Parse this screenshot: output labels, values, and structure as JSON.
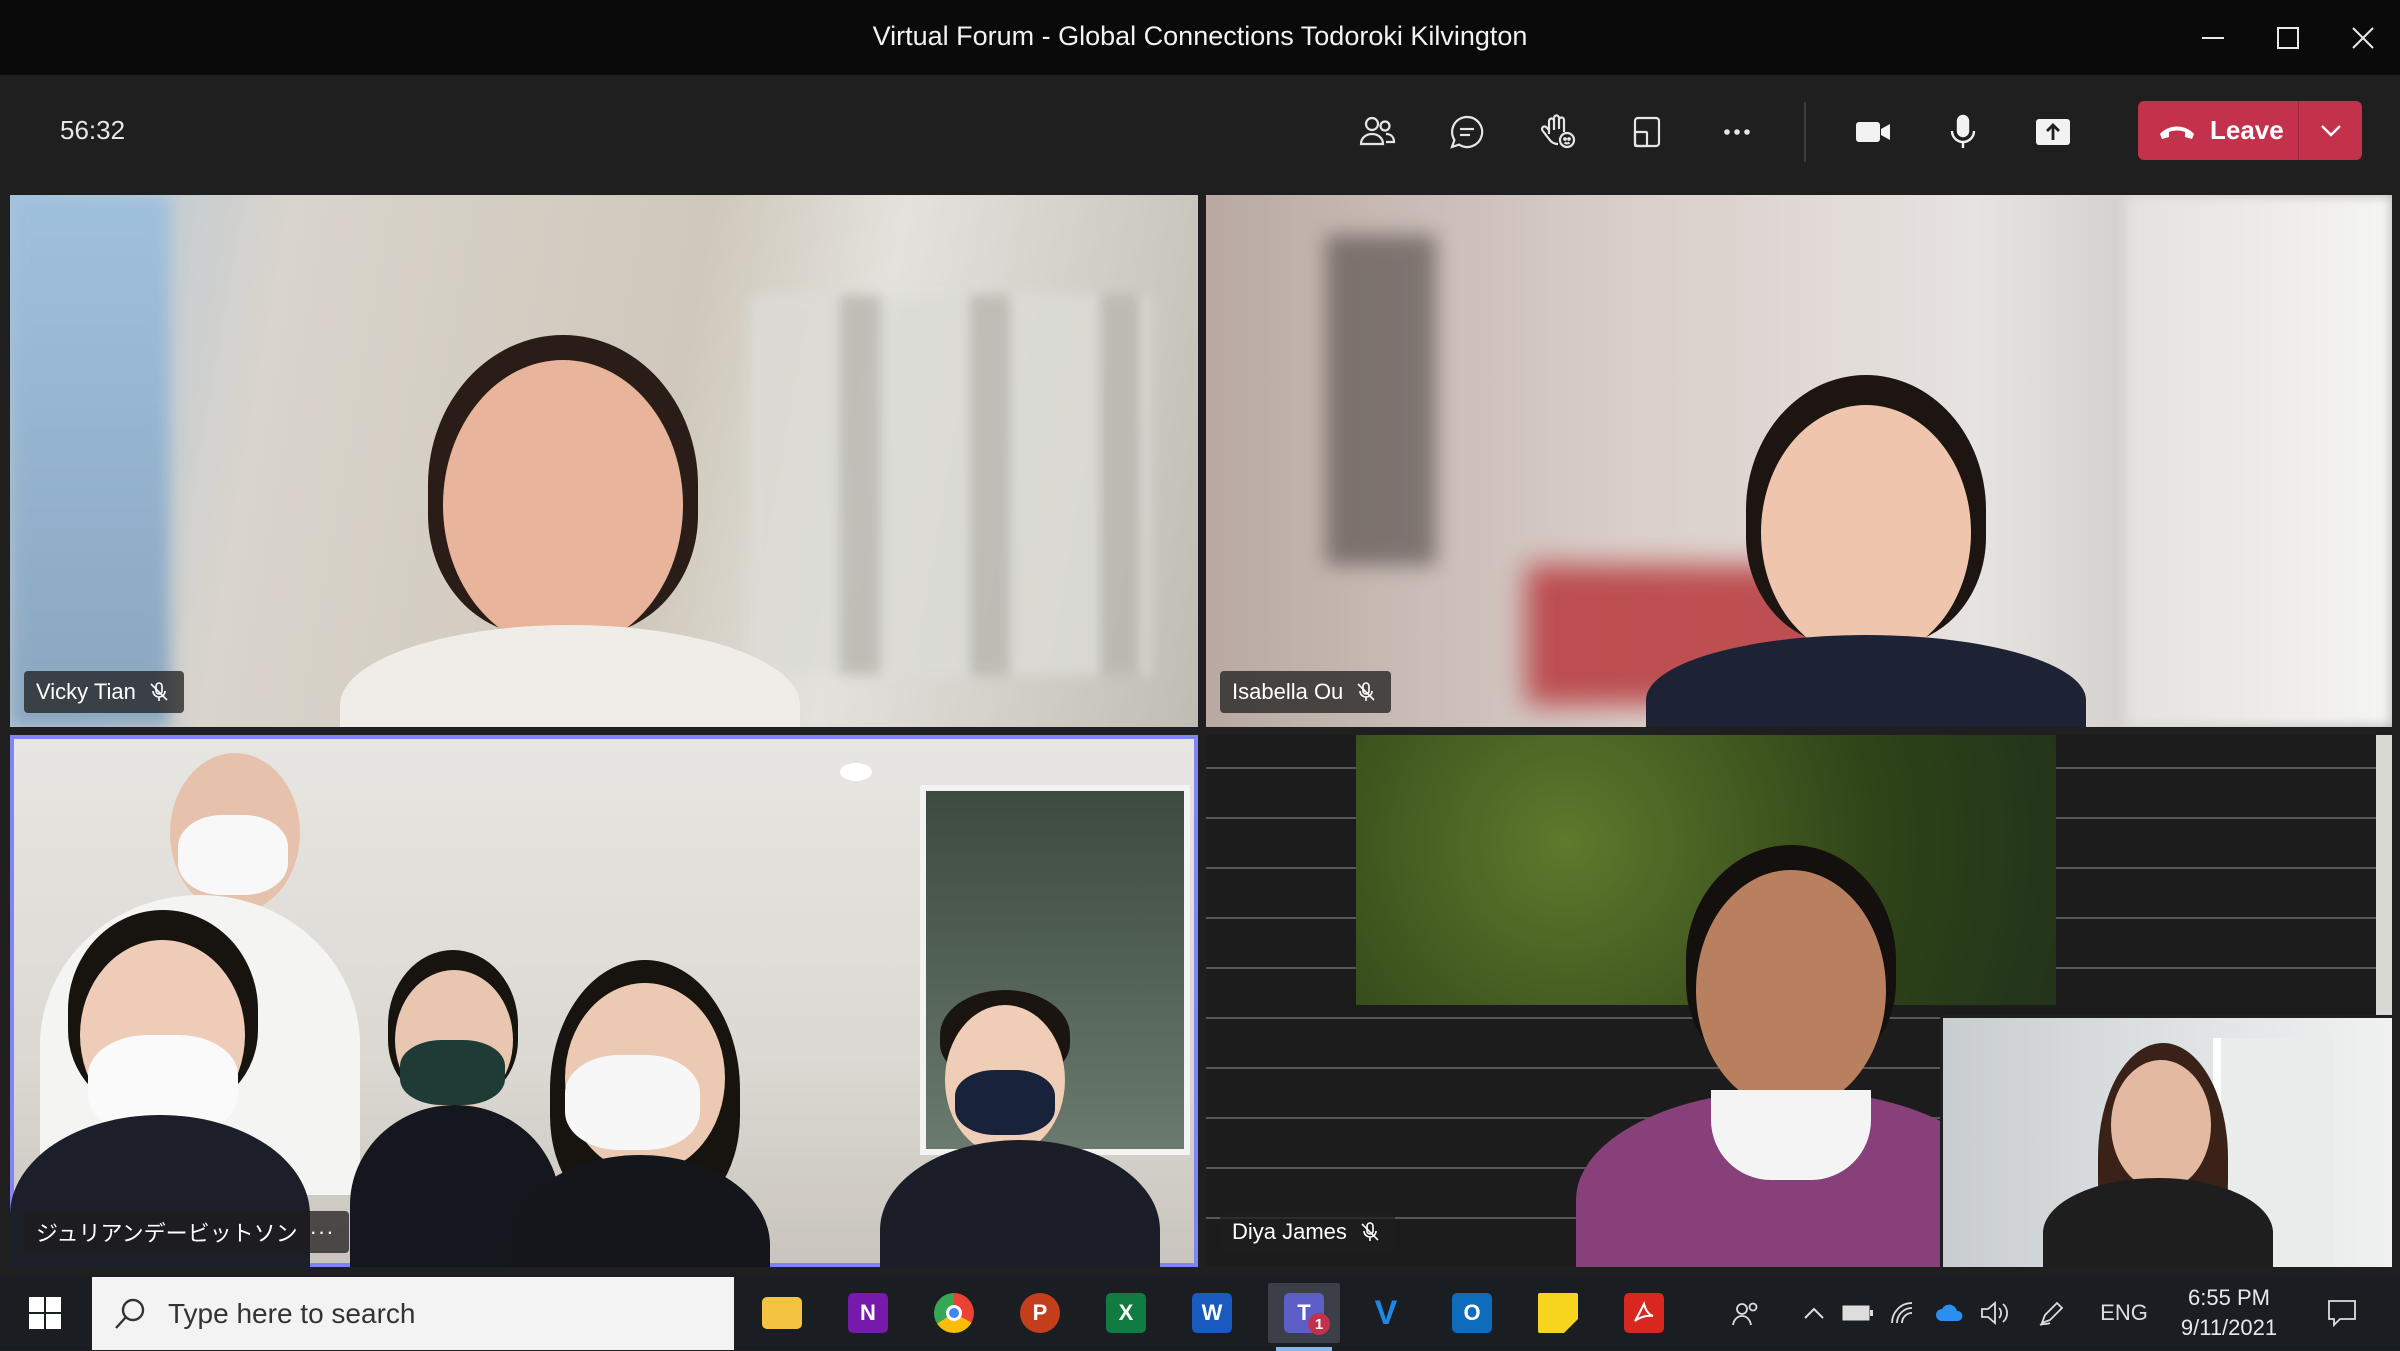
{
  "window": {
    "title": "Virtual Forum - Global Connections Todoroki Kilvington"
  },
  "meeting": {
    "elapsed": "56:32",
    "leave_label": "Leave",
    "accent_color": "#c4314b",
    "active_speaker_color": "#7f85f5"
  },
  "toolbar": {
    "icons": [
      "people-icon",
      "chat-icon",
      "raise-hand-icon",
      "layout-icon",
      "more-icon",
      "camera-icon",
      "microphone-icon",
      "share-icon"
    ]
  },
  "participants": [
    {
      "name": "Vicky Tian",
      "muted": true
    },
    {
      "name": "Isabella Ou",
      "muted": true
    },
    {
      "name": "ジュリアンデービットソン",
      "muted": false,
      "has_more": true,
      "more_label": "···",
      "speaking": true
    },
    {
      "name": "Diya James",
      "muted": true
    }
  ],
  "taskbar": {
    "search_placeholder": "Type here to search",
    "apps": [
      {
        "name": "File Explorer",
        "letter": "",
        "color": "#f5c342"
      },
      {
        "name": "OneNote",
        "letter": "N",
        "color": "#7719aa"
      },
      {
        "name": "Chrome",
        "letter": "",
        "color": "#34a853"
      },
      {
        "name": "PowerPoint",
        "letter": "P",
        "color": "#c43e1c"
      },
      {
        "name": "Excel",
        "letter": "X",
        "color": "#107c41"
      },
      {
        "name": "Word",
        "letter": "W",
        "color": "#185abd"
      },
      {
        "name": "Teams",
        "letter": "T",
        "color": "#5b5fc7",
        "badge": "1"
      },
      {
        "name": "V app",
        "letter": "V",
        "color": "#1e88e5"
      },
      {
        "name": "Outlook",
        "letter": "O",
        "color": "#0f6cbd"
      },
      {
        "name": "Sticky Notes",
        "letter": "",
        "color": "#f7d51e"
      },
      {
        "name": "Acrobat",
        "letter": "",
        "color": "#d7271f"
      }
    ],
    "language": "ENG",
    "time": "6:55 PM",
    "date": "9/11/2021"
  }
}
